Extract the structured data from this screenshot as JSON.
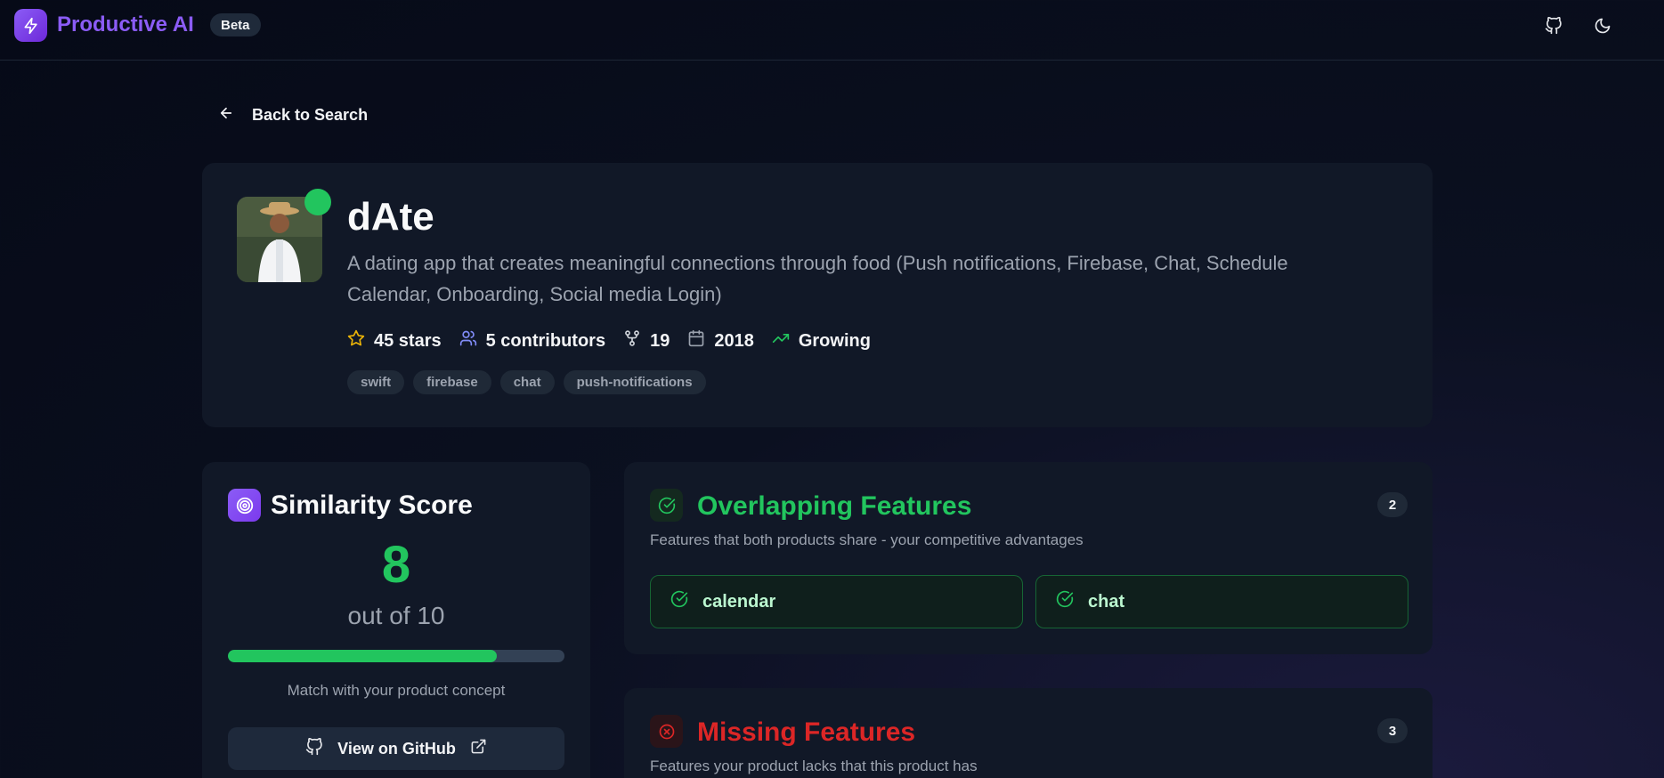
{
  "app": {
    "brand": "Productive AI",
    "badge": "Beta"
  },
  "nav": {
    "back_label": "Back to Search"
  },
  "repo": {
    "name": "dAte",
    "description": "A dating app that creates meaningful connections through food (Push notifications, Firebase, Chat, Schedule Calendar, Onboarding, Social media Login)",
    "stars": "45 stars",
    "contributors": "5 contributors",
    "forks": "19",
    "year": "2018",
    "trend": "Growing",
    "tags": [
      "swift",
      "firebase",
      "chat",
      "push-notifications"
    ]
  },
  "similarity": {
    "title": "Similarity Score",
    "score": "8",
    "out_of": "out of 10",
    "progress_fraction": 0.8,
    "caption": "Match with your product concept",
    "github_button": "View on GitHub"
  },
  "overlapping": {
    "title": "Overlapping Features",
    "subtitle": "Features that both products share - your competitive advantages",
    "count": "2",
    "items": [
      "calendar",
      "chat"
    ]
  },
  "missing": {
    "title": "Missing Features",
    "subtitle": "Features your product lacks that this product has",
    "count": "3"
  },
  "colors": {
    "accent": "#8b5cf6",
    "success": "#22c55e",
    "danger": "#dc2626",
    "card": "#111827"
  },
  "icons": {
    "logo": "lightning-icon",
    "header_left": "github-icon",
    "header_right": "moon-icon"
  }
}
